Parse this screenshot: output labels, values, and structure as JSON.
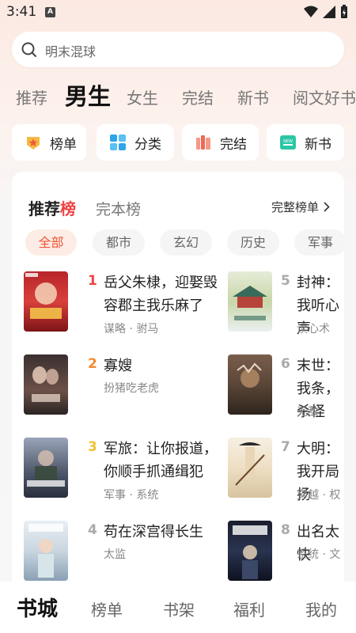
{
  "status": {
    "time": "3:41",
    "notif_icon": "A"
  },
  "search": {
    "placeholder": "明末混球"
  },
  "channels": [
    "推荐",
    "男生",
    "女生",
    "完结",
    "新书",
    "阅文好书"
  ],
  "quick_entries": [
    {
      "label": "榜单",
      "icon": "trophy-icon",
      "color": "#f2a733"
    },
    {
      "label": "分类",
      "icon": "grid-icon",
      "color": "#2ea5e8"
    },
    {
      "label": "完结",
      "icon": "books-icon",
      "color": "#f07a6a"
    },
    {
      "label": "新书",
      "icon": "new-icon",
      "color": "#2cc6a6"
    }
  ],
  "rank": {
    "tab_active_prefix": "推荐",
    "tab_active_accent": "榜",
    "tab_other": "完本榜",
    "full_label": "完整榜单",
    "genres": [
      "全部",
      "都市",
      "玄幻",
      "历史",
      "军事"
    ]
  },
  "books": [
    {
      "rank": "1",
      "title": "岳父朱棣，迎娶毁容郡主我乐麻了",
      "tags": "谋略 · 驸马",
      "rank_color": "#ee4444"
    },
    {
      "rank": "2",
      "title": "寡嫂",
      "tags": "扮猪吃老虎",
      "rank_color": "#f28a30"
    },
    {
      "rank": "3",
      "title": "军旅：让你报道，你顺手抓通缉犯",
      "tags": "军事 · 系统",
      "rank_color": "#f2c230"
    },
    {
      "rank": "4",
      "title": "苟在深宫得长生",
      "tags": "太监",
      "rank_color": "#aaaaaa"
    },
    {
      "rank": "5",
      "title": "封神：我听心声",
      "tags": "读心术",
      "rank_color": "#aaaaaa"
    },
    {
      "rank": "6",
      "title": "末世：我条，杀怪",
      "tags": "无敌",
      "rank_color": "#aaaaaa"
    },
    {
      "rank": "7",
      "title": "大明：我开局扬",
      "tags": "穿越 · 权",
      "rank_color": "#aaaaaa"
    },
    {
      "rank": "8",
      "title": "出名太快",
      "tags": "系统 · 文",
      "rank_color": "#aaaaaa"
    }
  ],
  "bottom_nav": [
    "书城",
    "榜单",
    "书架",
    "福利",
    "我的"
  ]
}
